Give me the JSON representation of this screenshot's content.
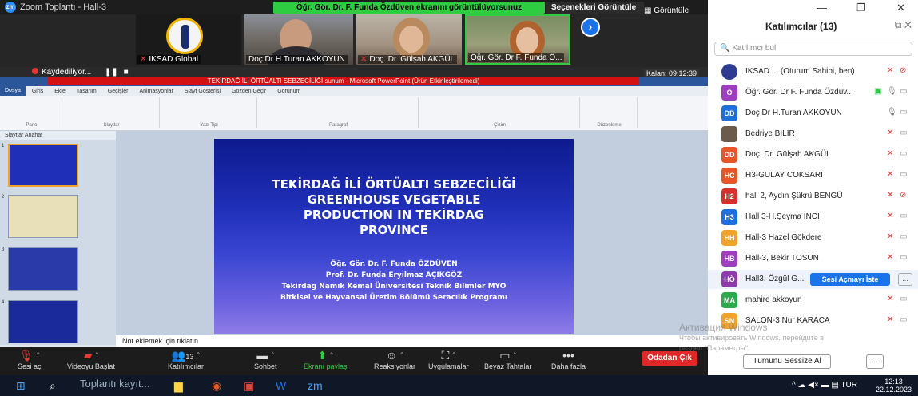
{
  "window": {
    "title": "Zoom Toplantı - Hall-3",
    "share_banner": "Öğr. Gör. Dr. F. Funda Özdüven ekranını görüntülüyorsunuz",
    "view_options": "Seçenekleri Görüntüle",
    "view_label": "Görüntüle"
  },
  "video_tiles": [
    {
      "name": "IKSAD Global"
    },
    {
      "name": "Doç Dr H.Turan AKKOYUN"
    },
    {
      "name": "Doç. Dr. Gülşah AKGÜL"
    },
    {
      "name": "Öğr. Gör. Dr F. Funda Ö..."
    }
  ],
  "recording": {
    "label": "Kaydediliyor...",
    "remaining": "Kalan: 09:12:39"
  },
  "ppt": {
    "titlebar": "TEKİRDAĞ İLİ ÖRTÜALTI SEBZECİLİĞİ sunum - Microsoft PowerPoint (Ürün Etkinleştirilemedi)",
    "tabs": [
      "Dosya",
      "Giriş",
      "Ekle",
      "Tasarım",
      "Geçişler",
      "Animasyonlar",
      "Slayt Gösterisi",
      "Gözden Geçir",
      "Görünüm"
    ],
    "ribbon_groups": [
      "Pano",
      "Slaytlar",
      "Yazı Tipi",
      "Paragraf",
      "Çizim",
      "Düzenleme"
    ],
    "panel_tabs": "Slaytlar    Anahat",
    "notes_placeholder": "Not eklemek için tıklatın"
  },
  "slide": {
    "title_tr": "TEKİRDAĞ İLİ ÖRTÜALTI SEBZECİLİĞİ",
    "title_en_1": "GREENHOUSE VEGETABLE",
    "title_en_2": "PRODUCTION IN TEKİRDAG",
    "title_en_3": "PROVINCE",
    "author_1": "Öğr. Gör. Dr. F. Funda ÖZDÜVEN",
    "author_2": "Prof. Dr. Funda Eryılmaz AÇIKGÖZ",
    "affil_1": "Tekirdağ Namık Kemal Üniversitesi Teknik Bilimler MYO",
    "affil_2": "Bitkisel ve Hayvansal Üretim Bölümü Seracılık Programı"
  },
  "controls": {
    "audio": "Sesi aç",
    "video": "Videoyu Başlat",
    "participants": "Katılımcılar",
    "participants_count": "13",
    "chat": "Sohbet",
    "share": "Ekranı paylaş",
    "reactions": "Reaksiyonlar",
    "apps": "Uygulamalar",
    "whiteboard": "Beyaz Tahtalar",
    "more": "Daha fazla",
    "leave": "Odadan Çık"
  },
  "panel": {
    "title": "Katılımcılar (13)",
    "search_placeholder": "Katılımcı bul",
    "participants": [
      {
        "initials": "",
        "name": "IKSAD ... (Oturum Sahibi, ben)",
        "color": "#2e3c8f"
      },
      {
        "initials": "Ö",
        "name": "Öğr. Gör. Dr F. Funda Özdüv...",
        "color": "#9b3fbf"
      },
      {
        "initials": "DD",
        "name": "Doç Dr H.Turan AKKOYUN",
        "color": "#1e6fd9"
      },
      {
        "initials": "",
        "name": "Bedriye BİLİR",
        "color": "#6b5b4a"
      },
      {
        "initials": "DD",
        "name": "Doç. Dr. Gülşah AKGÜL",
        "color": "#e8552a"
      },
      {
        "initials": "HC",
        "name": "H3-GULAY COKSARI",
        "color": "#e8552a"
      },
      {
        "initials": "H2",
        "name": "hall 2, Aydın Şükrü BENGÜ",
        "color": "#d6302c"
      },
      {
        "initials": "H3",
        "name": "Hall 3-H.Şeyma İNCİ",
        "color": "#1e6fd9"
      },
      {
        "initials": "HH",
        "name": "Hall-3 Hazel Gökdere",
        "color": "#f0a22a"
      },
      {
        "initials": "HB",
        "name": "Hall-3, Bekir TOSUN",
        "color": "#9b3fbf"
      },
      {
        "initials": "HÖ",
        "name": "Hall3, Özgül G...",
        "color": "#8e3aa8"
      },
      {
        "initials": "MA",
        "name": "mahire akkoyun",
        "color": "#2ea84c"
      },
      {
        "initials": "SN",
        "name": "SALON-3 Nur KARACA",
        "color": "#f0a22a"
      }
    ],
    "ask_unmute": "Sesi Açmayı İste",
    "more_mini": "...",
    "mute_all": "Tümünü Sessize Al",
    "more": "..."
  },
  "watermark": {
    "line1": "Активация Windows",
    "line2": "Чтобы активировать Windows, перейдите в",
    "line3": "раздел \"Параметры\"."
  },
  "taskbar": {
    "search_text": "Toplantı kayıt...",
    "lang": "TUR",
    "time": "12:13",
    "date": "22.12.2023"
  },
  "colors": {
    "zoom_blue": "#1a73e8",
    "share_green": "#2ecc40",
    "leave_red": "#e02828"
  }
}
